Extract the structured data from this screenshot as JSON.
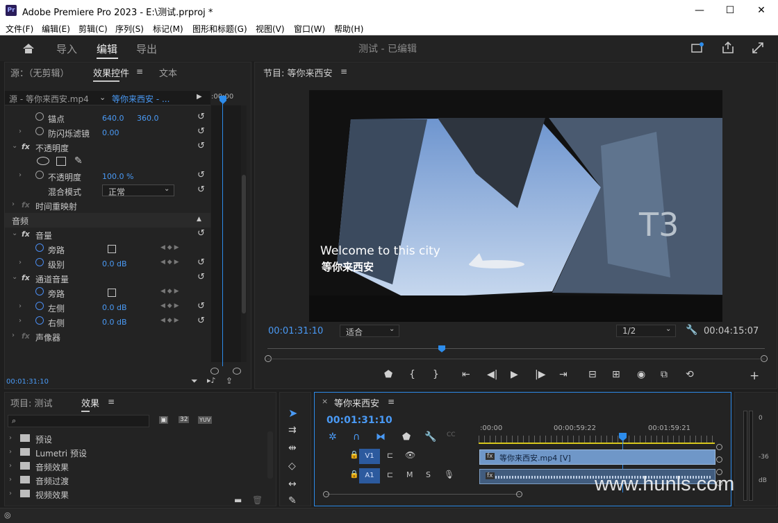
{
  "window": {
    "title": "Adobe Premiere Pro 2023 - E:\\测试.prproj *",
    "logo": "Pr"
  },
  "menu": [
    "文件(F)",
    "编辑(E)",
    "剪辑(C)",
    "序列(S)",
    "标记(M)",
    "图形和标题(G)",
    "视图(V)",
    "窗口(W)",
    "帮助(H)"
  ],
  "workspace": {
    "tabs": [
      "导入",
      "编辑",
      "导出"
    ],
    "active": "编辑",
    "project_title": "测试 - 已编辑"
  },
  "source_panel": {
    "tabs": [
      "源：（无剪辑）",
      "效果控件",
      "文本"
    ],
    "source_clip": "源 - 等你来西安.mp4",
    "seq_clip": "等你来西安 - ...",
    "timecode_top": ":00:00",
    "timecode": "00:01:31:10"
  },
  "effects": {
    "anchor": {
      "label": "锚点",
      "x": "640.0",
      "y": "360.0"
    },
    "flicker": {
      "label": "防闪烁滤镜",
      "value": "0.00"
    },
    "opacity_group": {
      "label": "不透明度"
    },
    "opacity": {
      "label": "不透明度",
      "value": "100.0 %"
    },
    "blend": {
      "label": "混合模式",
      "value": "正常"
    },
    "time_remap": {
      "label": "时间重映射"
    },
    "audio_header": "音频",
    "volume": {
      "label": "音量"
    },
    "bypass1": {
      "label": "旁路"
    },
    "level": {
      "label": "级别",
      "value": "0.0 dB"
    },
    "channel_volume": {
      "label": "通道音量"
    },
    "bypass2": {
      "label": "旁路"
    },
    "left": {
      "label": "左侧",
      "value": "0.0 dB"
    },
    "right": {
      "label": "右侧",
      "value": "0.0 dB"
    },
    "panner": {
      "label": "声像器"
    }
  },
  "program": {
    "title": "节目: 等你来西安",
    "timecode": "00:01:31:10",
    "fit": "适合",
    "resolution": "1/2",
    "duration": "00:04:15:07",
    "overlay_en": "Welcome to this city",
    "overlay_cn": "等你来西安"
  },
  "project_panel": {
    "tabs": [
      "项目: 测试",
      "效果"
    ],
    "items": [
      "预设",
      "Lumetri 预设",
      "音频效果",
      "音频过渡",
      "视频效果"
    ]
  },
  "timeline": {
    "title": "等你来西安",
    "timecode": "00:01:31:10",
    "ruler": [
      ":00:00",
      "00:00:59:22",
      "00:01:59:21"
    ],
    "v1": "V1",
    "a1": "A1",
    "v_clip": "等你来西安.mp4 [V]",
    "m": "M",
    "s": "S"
  },
  "meter": {
    "labels": [
      "0",
      "-36",
      "dB"
    ]
  },
  "watermark": "www.hunls.com"
}
